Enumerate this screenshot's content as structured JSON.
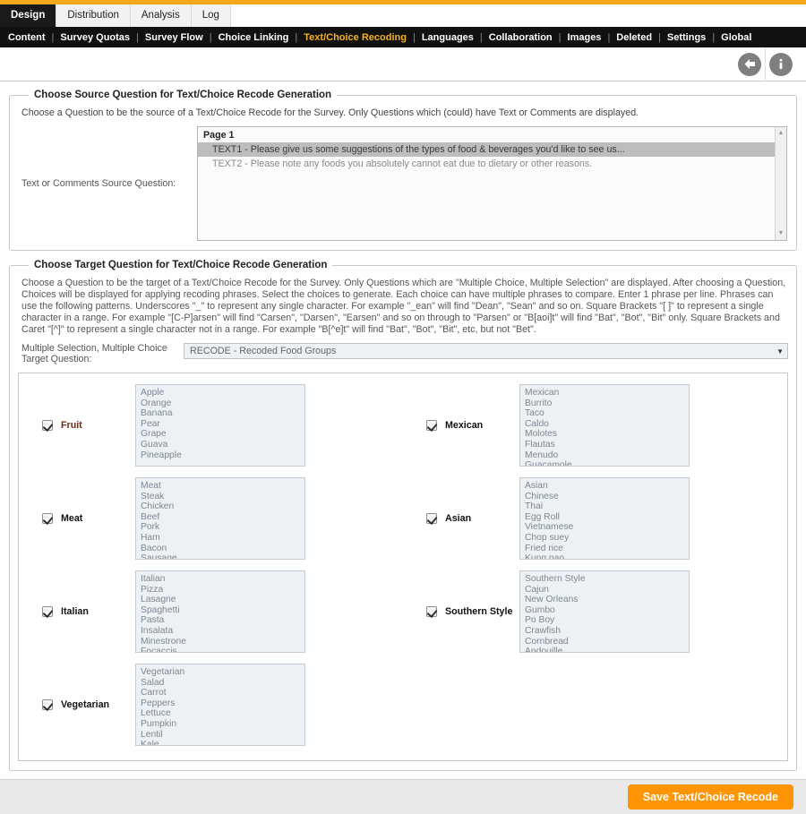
{
  "app": {
    "accent_orange": "#f7a81b",
    "button_orange": "#ff9505",
    "subnav_highlight": "#f5b21b"
  },
  "tabs": [
    {
      "label": "Design",
      "active": true
    },
    {
      "label": "Distribution",
      "active": false
    },
    {
      "label": "Analysis",
      "active": false
    },
    {
      "label": "Log",
      "active": false
    }
  ],
  "subnav": {
    "items": [
      {
        "label": "Content",
        "current": false
      },
      {
        "label": "Survey Quotas",
        "current": false
      },
      {
        "label": "Survey Flow",
        "current": false
      },
      {
        "label": "Choice Linking",
        "current": false
      },
      {
        "label": "Text/Choice Recoding",
        "current": true
      },
      {
        "label": "Languages",
        "current": false
      },
      {
        "label": "Collaboration",
        "current": false
      },
      {
        "label": "Images",
        "current": false
      },
      {
        "label": "Deleted",
        "current": false
      },
      {
        "label": "Settings",
        "current": false
      },
      {
        "label": "Global",
        "current": false
      }
    ],
    "separator": "|"
  },
  "toolbar": {
    "back_icon": "back-arrow-icon",
    "info_icon": "info-icon"
  },
  "source_panel": {
    "legend": "Choose Source Question for Text/Choice Recode Generation",
    "description": "Choose a Question to be the source of a Text/Choice Recode for the Survey. Only Questions which (could) have Text or Comments are displayed.",
    "field_label": "Text or Comments Source Question:",
    "list": {
      "group": "Page 1",
      "items": [
        {
          "label": "TEXT1 - Please give us some suggestions of the types of food & beverages you'd like to see us...",
          "selected": true
        },
        {
          "label": "TEXT2 - Please note any foods you absolutely cannot eat due to dietary or other reasons.",
          "selected": false
        }
      ],
      "scroll_up": "▲",
      "scroll_down": "▼"
    }
  },
  "target_panel": {
    "legend": "Choose Target Question for Text/Choice Recode Generation",
    "description": "Choose a Question to be the target of a Text/Choice Recode for the Survey. Only Questions which are \"Multiple Choice, Multiple Selection\" are displayed. After choosing a Question, Choices will be displayed for applying recoding phrases. Select the choices to generate. Each choice can have multiple phrases to compare. Enter 1 phrase per line. Phrases can use the following patterns. Underscores \"_\" to represent any single character. For example \"_ean\" will find \"Dean\", \"Sean\" and so on. Square Brackets \"[ ]\" to represent a single character in a range. For example \"[C-P]arsen\" will find \"Carsen\", \"Darsen\", \"Earsen\" and so on through to \"Parsen\" or \"B[aoi]t\" will find \"Bat\", \"Bot\", \"Bit\" only. Square Brackets and Caret \"[^]\" to represent a single character not in a range. For example \"B[^e]t\" will find \"Bat\", \"Bot\", \"Bit\", etc, but not \"Bet\".",
    "select_label": "Multiple Selection, Multiple Choice Target Question:",
    "select_value": "RECODE - Recoded Food Groups",
    "select_caret": "▼",
    "choices": [
      {
        "name": "Fruit",
        "checked": true,
        "accent": true,
        "phrases": [
          "Apple",
          "Orange",
          "Banana",
          "Pear",
          "Grape",
          "Guava",
          "Pineapple"
        ]
      },
      {
        "name": "Mexican",
        "checked": true,
        "accent": false,
        "phrases": [
          "Mexican",
          "Burrito",
          "Taco",
          "Caldo",
          "Molotes",
          "Flautas",
          "Menudo",
          "Guacamole"
        ]
      },
      {
        "name": "Meat",
        "checked": true,
        "accent": false,
        "phrases": [
          "Meat",
          "Steak",
          "Chicken",
          "Beef",
          "Pork",
          "Ham",
          "Bacon",
          "Sausage"
        ]
      },
      {
        "name": "Asian",
        "checked": true,
        "accent": false,
        "phrases": [
          "Asian",
          "Chinese",
          "Thai",
          "Egg Roll",
          "Vietnamese",
          "Chop suey",
          "Fried rice",
          "Kung pao"
        ]
      },
      {
        "name": "Italian",
        "checked": true,
        "accent": false,
        "phrases": [
          "Italian",
          "Pizza",
          "Lasagne",
          "Spaghetti",
          "Pasta",
          "Insalata",
          "Minestrone",
          "Focaccis"
        ]
      },
      {
        "name": "Southern Style",
        "checked": true,
        "accent": false,
        "phrases": [
          "Southern Style",
          "Cajun",
          "New Orleans",
          "Gumbo",
          "Po Boy",
          "Crawfish",
          "Cornbread",
          "Andouille"
        ]
      },
      {
        "name": "Vegetarian",
        "checked": true,
        "accent": false,
        "phrases": [
          "Vegetarian",
          "Salad",
          "Carrot",
          "Peppers",
          "Lettuce",
          "Pumpkin",
          "Lentil",
          "Kale"
        ]
      }
    ]
  },
  "footer": {
    "save_label": "Save Text/Choice Recode"
  }
}
